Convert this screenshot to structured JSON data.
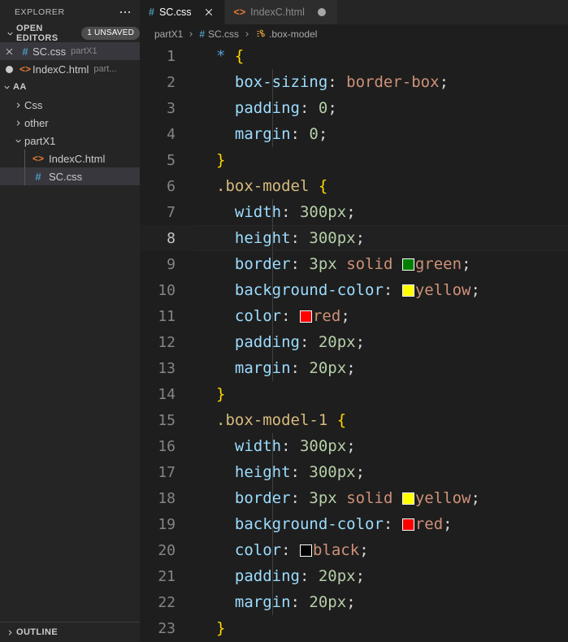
{
  "sidebar": {
    "header_title": "EXPLORER",
    "more_icon": "more-actions-icon",
    "open_editors": {
      "label": "OPEN EDITORS",
      "badge": "1 UNSAVED",
      "items": [
        {
          "name": "SC.css",
          "desc": "partX1",
          "icon": "css-file-icon",
          "lead": "close-icon",
          "selected": true
        },
        {
          "name": "IndexC.html",
          "desc": "part...",
          "icon": "html-file-icon",
          "lead": "dirty-dot-icon",
          "selected": false
        }
      ]
    },
    "tree": {
      "root_label": "AA",
      "items": [
        {
          "label": "Css",
          "type": "folder",
          "expanded": false,
          "depth": 1
        },
        {
          "label": "other",
          "type": "folder",
          "expanded": false,
          "depth": 1
        },
        {
          "label": "partX1",
          "type": "folder",
          "expanded": true,
          "depth": 1
        },
        {
          "label": "IndexC.html",
          "type": "html",
          "depth": 2,
          "selected": false
        },
        {
          "label": "SC.css",
          "type": "css",
          "depth": 2,
          "selected": true
        }
      ]
    },
    "outline_label": "OUTLINE"
  },
  "tabs": [
    {
      "label": "SC.css",
      "icon": "css-file-icon",
      "active": true,
      "action": "close-icon"
    },
    {
      "label": "IndexC.html",
      "icon": "html-file-icon",
      "active": false,
      "action": "dirty-dot-icon"
    }
  ],
  "breadcrumbs": [
    {
      "label": "partX1",
      "icon": null
    },
    {
      "label": "SC.css",
      "icon": "css-file-icon"
    },
    {
      "label": ".box-model",
      "icon": "css-rule-icon"
    }
  ],
  "editor": {
    "current_line": 8,
    "swatch_colors": {
      "green": "#008000",
      "yellow": "#ffff00",
      "red": "#ff0000",
      "black": "#000000"
    },
    "lines": [
      {
        "n": 1,
        "indent": false,
        "tokens": [
          {
            "t": "*",
            "c": "t-star"
          },
          {
            "t": " ",
            "c": "t-punct"
          },
          {
            "t": "{",
            "c": "t-brace"
          }
        ]
      },
      {
        "n": 2,
        "indent": true,
        "tokens": [
          {
            "t": "  ",
            "c": "t-punct"
          },
          {
            "t": "box-sizing",
            "c": "t-prop"
          },
          {
            "t": ": ",
            "c": "t-punct"
          },
          {
            "t": "border-box",
            "c": "t-val"
          },
          {
            "t": ";",
            "c": "t-punct"
          }
        ]
      },
      {
        "n": 3,
        "indent": true,
        "tokens": [
          {
            "t": "  ",
            "c": "t-punct"
          },
          {
            "t": "padding",
            "c": "t-prop"
          },
          {
            "t": ": ",
            "c": "t-punct"
          },
          {
            "t": "0",
            "c": "t-num"
          },
          {
            "t": ";",
            "c": "t-punct"
          }
        ]
      },
      {
        "n": 4,
        "indent": true,
        "tokens": [
          {
            "t": "  ",
            "c": "t-punct"
          },
          {
            "t": "margin",
            "c": "t-prop"
          },
          {
            "t": ": ",
            "c": "t-punct"
          },
          {
            "t": "0",
            "c": "t-num"
          },
          {
            "t": ";",
            "c": "t-punct"
          }
        ]
      },
      {
        "n": 5,
        "indent": false,
        "tokens": [
          {
            "t": "}",
            "c": "t-brace"
          }
        ]
      },
      {
        "n": 6,
        "indent": false,
        "tokens": [
          {
            "t": ".box-model",
            "c": "t-sel"
          },
          {
            "t": " ",
            "c": "t-punct"
          },
          {
            "t": "{",
            "c": "t-brace"
          }
        ]
      },
      {
        "n": 7,
        "indent": true,
        "tokens": [
          {
            "t": "  ",
            "c": "t-punct"
          },
          {
            "t": "width",
            "c": "t-prop"
          },
          {
            "t": ": ",
            "c": "t-punct"
          },
          {
            "t": "300px",
            "c": "t-num"
          },
          {
            "t": ";",
            "c": "t-punct"
          }
        ]
      },
      {
        "n": 8,
        "indent": true,
        "tokens": [
          {
            "t": "  ",
            "c": "t-punct"
          },
          {
            "t": "height",
            "c": "t-prop"
          },
          {
            "t": ": ",
            "c": "t-punct"
          },
          {
            "t": "300px",
            "c": "t-num"
          },
          {
            "t": ";",
            "c": "t-punct"
          }
        ]
      },
      {
        "n": 9,
        "indent": true,
        "tokens": [
          {
            "t": "  ",
            "c": "t-punct"
          },
          {
            "t": "border",
            "c": "t-prop"
          },
          {
            "t": ": ",
            "c": "t-punct"
          },
          {
            "t": "3px",
            "c": "t-num"
          },
          {
            "t": " ",
            "c": "t-punct"
          },
          {
            "t": "solid",
            "c": "t-val"
          },
          {
            "t": " ",
            "c": "t-punct"
          },
          {
            "sw": "#008000"
          },
          {
            "t": "green",
            "c": "t-val"
          },
          {
            "t": ";",
            "c": "t-punct"
          }
        ]
      },
      {
        "n": 10,
        "indent": true,
        "tokens": [
          {
            "t": "  ",
            "c": "t-punct"
          },
          {
            "t": "background-color",
            "c": "t-prop"
          },
          {
            "t": ": ",
            "c": "t-punct"
          },
          {
            "sw": "#ffff00"
          },
          {
            "t": "yellow",
            "c": "t-val"
          },
          {
            "t": ";",
            "c": "t-punct"
          }
        ]
      },
      {
        "n": 11,
        "indent": true,
        "tokens": [
          {
            "t": "  ",
            "c": "t-punct"
          },
          {
            "t": "color",
            "c": "t-prop"
          },
          {
            "t": ": ",
            "c": "t-punct"
          },
          {
            "sw": "#ff0000"
          },
          {
            "t": "red",
            "c": "t-val"
          },
          {
            "t": ";",
            "c": "t-punct"
          }
        ]
      },
      {
        "n": 12,
        "indent": true,
        "tokens": [
          {
            "t": "  ",
            "c": "t-punct"
          },
          {
            "t": "padding",
            "c": "t-prop"
          },
          {
            "t": ": ",
            "c": "t-punct"
          },
          {
            "t": "20px",
            "c": "t-num"
          },
          {
            "t": ";",
            "c": "t-punct"
          }
        ]
      },
      {
        "n": 13,
        "indent": true,
        "tokens": [
          {
            "t": "  ",
            "c": "t-punct"
          },
          {
            "t": "margin",
            "c": "t-prop"
          },
          {
            "t": ": ",
            "c": "t-punct"
          },
          {
            "t": "20px",
            "c": "t-num"
          },
          {
            "t": ";",
            "c": "t-punct"
          }
        ]
      },
      {
        "n": 14,
        "indent": false,
        "tokens": [
          {
            "t": "}",
            "c": "t-brace"
          }
        ]
      },
      {
        "n": 15,
        "indent": false,
        "tokens": [
          {
            "t": ".box-model-1",
            "c": "t-sel"
          },
          {
            "t": " ",
            "c": "t-punct"
          },
          {
            "t": "{",
            "c": "t-brace"
          }
        ]
      },
      {
        "n": 16,
        "indent": true,
        "tokens": [
          {
            "t": "  ",
            "c": "t-punct"
          },
          {
            "t": "width",
            "c": "t-prop"
          },
          {
            "t": ": ",
            "c": "t-punct"
          },
          {
            "t": "300px",
            "c": "t-num"
          },
          {
            "t": ";",
            "c": "t-punct"
          }
        ]
      },
      {
        "n": 17,
        "indent": true,
        "tokens": [
          {
            "t": "  ",
            "c": "t-punct"
          },
          {
            "t": "height",
            "c": "t-prop"
          },
          {
            "t": ": ",
            "c": "t-punct"
          },
          {
            "t": "300px",
            "c": "t-num"
          },
          {
            "t": ";",
            "c": "t-punct"
          }
        ]
      },
      {
        "n": 18,
        "indent": true,
        "tokens": [
          {
            "t": "  ",
            "c": "t-punct"
          },
          {
            "t": "border",
            "c": "t-prop"
          },
          {
            "t": ": ",
            "c": "t-punct"
          },
          {
            "t": "3px",
            "c": "t-num"
          },
          {
            "t": " ",
            "c": "t-punct"
          },
          {
            "t": "solid",
            "c": "t-val"
          },
          {
            "t": " ",
            "c": "t-punct"
          },
          {
            "sw": "#ffff00"
          },
          {
            "t": "yellow",
            "c": "t-val"
          },
          {
            "t": ";",
            "c": "t-punct"
          }
        ]
      },
      {
        "n": 19,
        "indent": true,
        "tokens": [
          {
            "t": "  ",
            "c": "t-punct"
          },
          {
            "t": "background-color",
            "c": "t-prop"
          },
          {
            "t": ": ",
            "c": "t-punct"
          },
          {
            "sw": "#ff0000"
          },
          {
            "t": "red",
            "c": "t-val"
          },
          {
            "t": ";",
            "c": "t-punct"
          }
        ]
      },
      {
        "n": 20,
        "indent": true,
        "tokens": [
          {
            "t": "  ",
            "c": "t-punct"
          },
          {
            "t": "color",
            "c": "t-prop"
          },
          {
            "t": ": ",
            "c": "t-punct"
          },
          {
            "sw": "#000000"
          },
          {
            "t": "black",
            "c": "t-val"
          },
          {
            "t": ";",
            "c": "t-punct"
          }
        ]
      },
      {
        "n": 21,
        "indent": true,
        "tokens": [
          {
            "t": "  ",
            "c": "t-punct"
          },
          {
            "t": "padding",
            "c": "t-prop"
          },
          {
            "t": ": ",
            "c": "t-punct"
          },
          {
            "t": "20px",
            "c": "t-num"
          },
          {
            "t": ";",
            "c": "t-punct"
          }
        ]
      },
      {
        "n": 22,
        "indent": true,
        "tokens": [
          {
            "t": "  ",
            "c": "t-punct"
          },
          {
            "t": "margin",
            "c": "t-prop"
          },
          {
            "t": ": ",
            "c": "t-punct"
          },
          {
            "t": "20px",
            "c": "t-num"
          },
          {
            "t": ";",
            "c": "t-punct"
          }
        ]
      },
      {
        "n": 23,
        "indent": false,
        "tokens": [
          {
            "t": "}",
            "c": "t-brace"
          }
        ]
      }
    ]
  }
}
